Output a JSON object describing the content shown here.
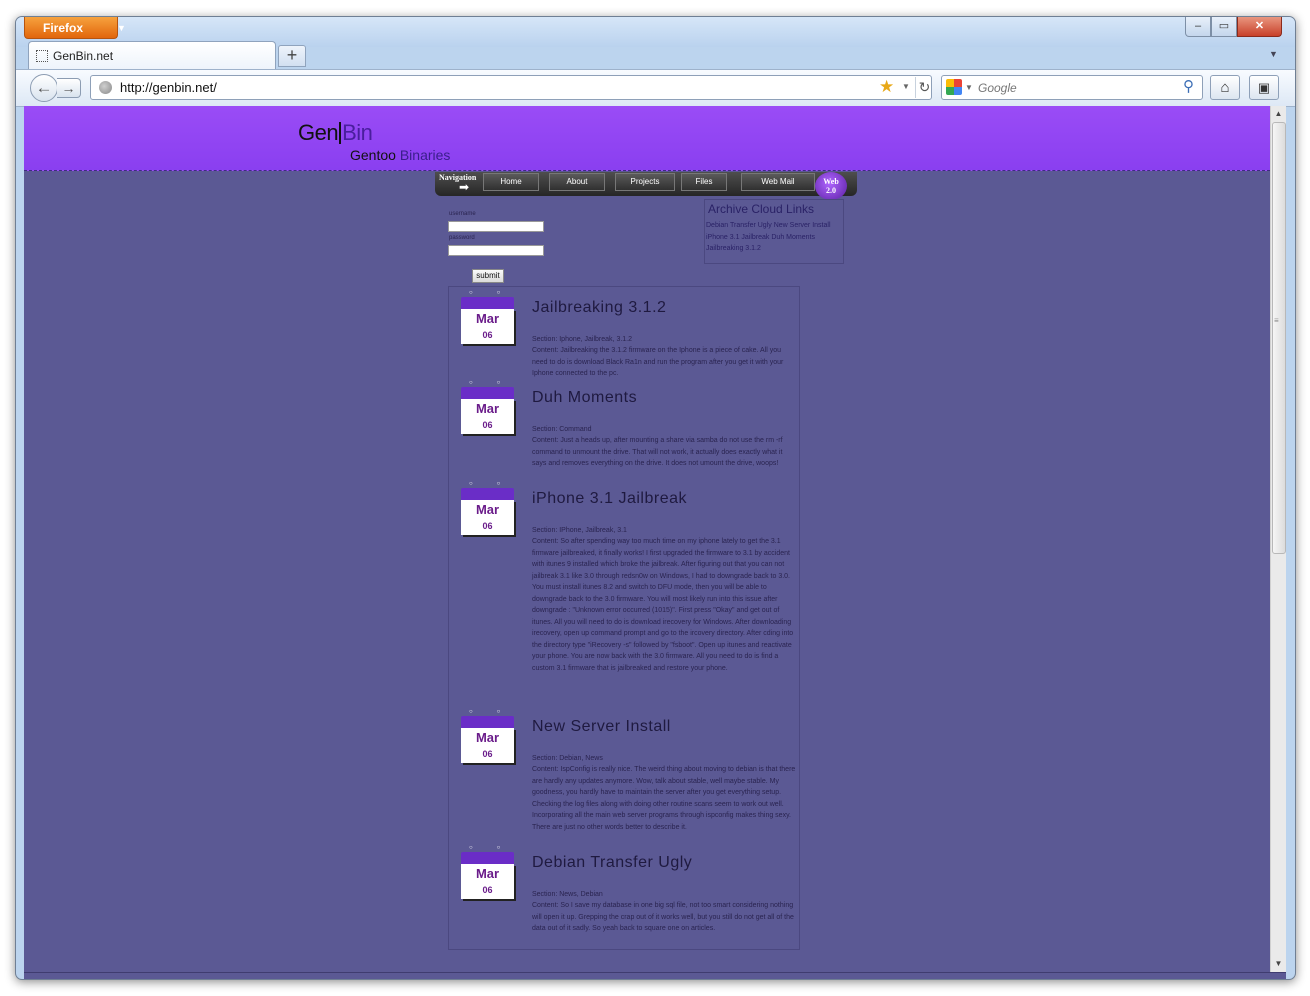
{
  "browser": {
    "app_button": "Firefox",
    "window_controls": {
      "minimize": "‒",
      "maximize": "▭",
      "close": "✕"
    },
    "tab_title": "GenBin.net",
    "new_tab": "+",
    "url": "http://genbin.net/",
    "search_placeholder": "Google"
  },
  "site": {
    "logo_gen": "Gen",
    "logo_bin": "Bin",
    "tagline_a": "Gentoo",
    "tagline_b": "Binaries"
  },
  "nav": {
    "label": "Navigation",
    "items": [
      "Home",
      "About",
      "Projects",
      "Files",
      "Web Mail"
    ],
    "badge_a": "Web",
    "badge_b": "2.0"
  },
  "login": {
    "username_label": "username",
    "password_label": "password",
    "submit": "submit"
  },
  "archive": {
    "title": "Archive Cloud Links",
    "links": "Debian Transfer Ugly New Server Install iPhone 3.1 Jailbreak Duh Moments Jailbreaking 3.1.2"
  },
  "posts": [
    {
      "month": "Mar",
      "day": "06",
      "title": "Jailbreaking 3.1.2",
      "section": "Section: Iphone, Jailbreak, 3.1.2",
      "content": "Content: Jailbreaking the 3.1.2 firmware on the Iphone is a piece of cake. All you need to do is download Black Ra1n and run the program after you get it with your Iphone connected to the pc."
    },
    {
      "month": "Mar",
      "day": "06",
      "title": "Duh Moments",
      "section": "Section: Command",
      "content": "Content: Just a heads up, after mounting a share via samba do not use the rm -rf command to unmount the drive. That will not work, it actually does exactly what it says and removes everything on the drive. It does not umount the drive, woops!"
    },
    {
      "month": "Mar",
      "day": "06",
      "title": "iPhone 3.1 Jailbreak",
      "section": "Section: IPhone, Jailbreak, 3.1",
      "content": "Content: So after spending way too much time on my iphone lately to get the 3.1 firmware jailbreaked, it finally works! I first upgraded the firmware to 3.1 by accident with itunes 9 installed which broke the jailbreak. After figuring out that you can not jailbreak 3.1 like 3.0 through redsn0w on Windows, I had to downgrade back to 3.0. You must install itunes 8.2 and switch to DFU mode, then you will be able to downgrade back to the 3.0 firmware. You will most likely run into this issue after downgrade : \"Unknown error occurred (1015)\". First press \"Okay\" and get out of itunes. All you will need to do is download irecovery for Windows. After downloading irecovery, open up command prompt and go to the ircovery directory. After cding into the directory type \"iRecovery -s\" followed by \"fsboot\". Open up itunes and reactivate your phone. You are now back with the 3.0 firmware. All you need to do is find a custom 3.1 firmware that is jailbreaked and restore your phone."
    },
    {
      "month": "Mar",
      "day": "06",
      "title": "New Server Install",
      "section": "Section: Debian, News",
      "content": "Content: IspConfig is really nice. The weird thing about moving to debian is that there are hardly any updates anymore. Wow, talk about stable, well maybe stable. My goodness, you hardly have to maintain the server after you get everything setup. Checking the log files along with doing other routine scans seem to work out well. Incorporating all the main web server programs through ispconfig makes thing sexy. There are just no other words better to describe it."
    },
    {
      "month": "Mar",
      "day": "06",
      "title": "Debian Transfer Ugly",
      "section": "Section: News, Debian",
      "content": "Content: So I save my database in one big sql file, not too smart considering nothing will open it up. Grepping the crap out of it works well, but you still do not get all of the data out of it sadly. So yeah back to square one on articles."
    }
  ],
  "colors": {
    "page_bg": "#5b5994",
    "header_bg": "#9a4cf6",
    "calendar_top": "#6a2dc7",
    "calendar_text": "#6a1c8a",
    "firefox_button": "#e8761a"
  }
}
